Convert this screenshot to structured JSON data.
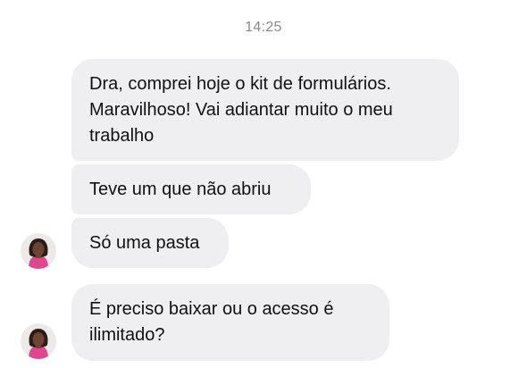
{
  "thread": {
    "timestamp": "14:25",
    "messages": [
      {
        "text": "Dra, comprei hoje o kit de formulários.\nMaravilhoso! Vai adiantar muito o meu\ntrabalho"
      },
      {
        "text": "Teve um que não abriu"
      },
      {
        "text": "Só uma pasta"
      },
      {
        "text": "É preciso baixar ou o acesso é\nilimitado?"
      }
    ]
  },
  "colors": {
    "bubble": "#efeff1",
    "timestamp": "#8a8a8e",
    "avatar_outfit": "#e0468f"
  },
  "icons": {
    "avatar": "profile-photo-icon"
  }
}
